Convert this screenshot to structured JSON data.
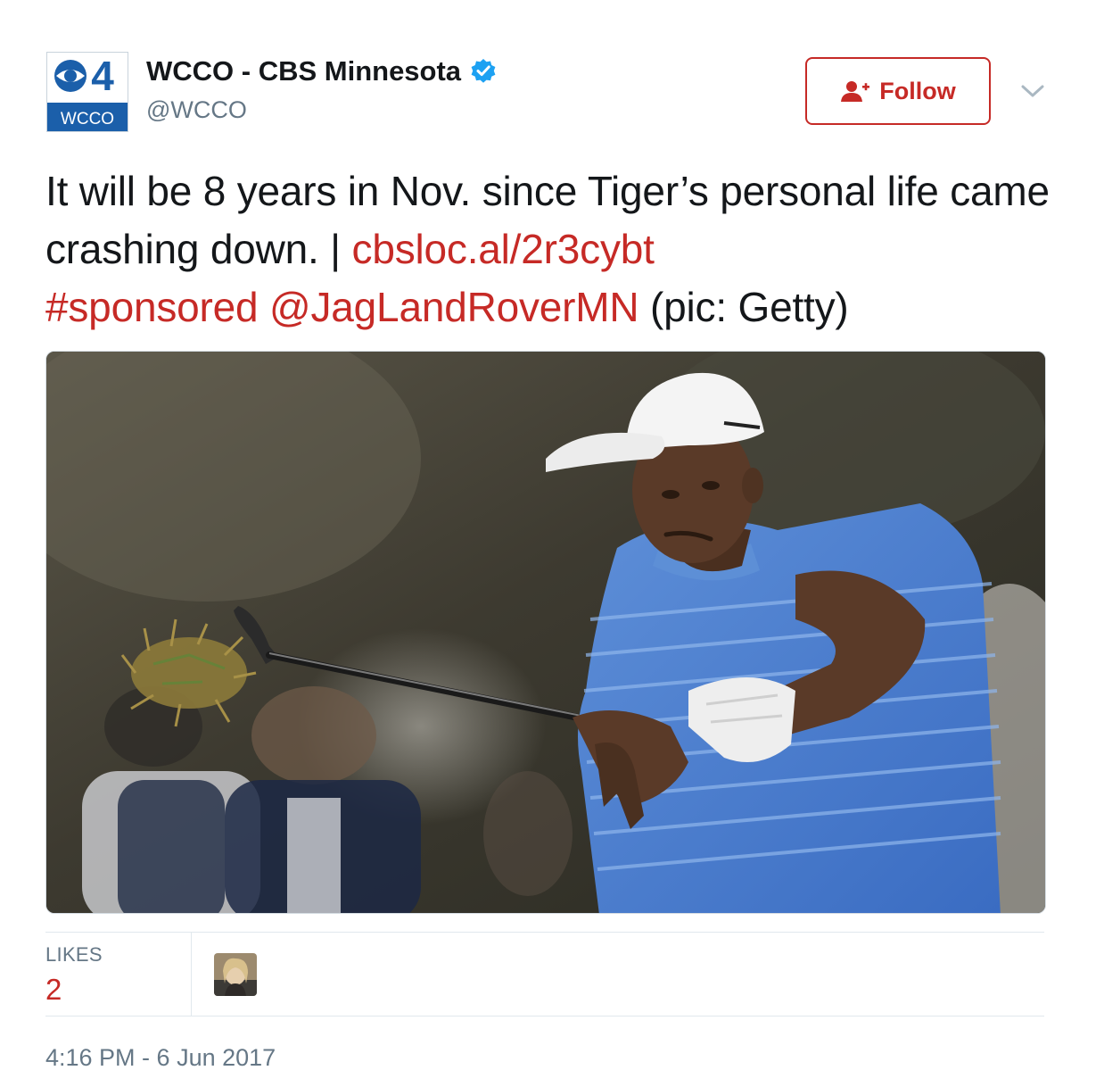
{
  "tweet": {
    "author": {
      "display_name": "WCCO - CBS Minnesota",
      "handle": "@WCCO",
      "verified": true,
      "avatar_logo_number": "4",
      "avatar_logo_text": "WCCO"
    },
    "follow_label": "Follow",
    "text_segments": {
      "plain_1": "It will be 8 years in Nov. since Tiger’s personal life came crashing down. | ",
      "link": "cbsloc.al/2r3cybt",
      "hashtag": "#sponsored",
      "mention": "@JagLandRoverMN",
      "plain_2": " (pic: Getty)"
    },
    "media": {
      "icon": "photo",
      "caption_shown": false
    },
    "stats": {
      "likes_label": "LIKES",
      "likes_count": "2"
    },
    "timestamp": "4:16 PM - 6 Jun 2017"
  },
  "colors": {
    "accent": "#c62a26",
    "text": "#14171a",
    "secondary": "#657786",
    "verified": "#1da1f2",
    "cbs_blue": "#1b5faa"
  },
  "icons": {
    "verified": "verified-badge-icon",
    "follow": "person-plus-icon",
    "more": "chevron-down-icon"
  }
}
